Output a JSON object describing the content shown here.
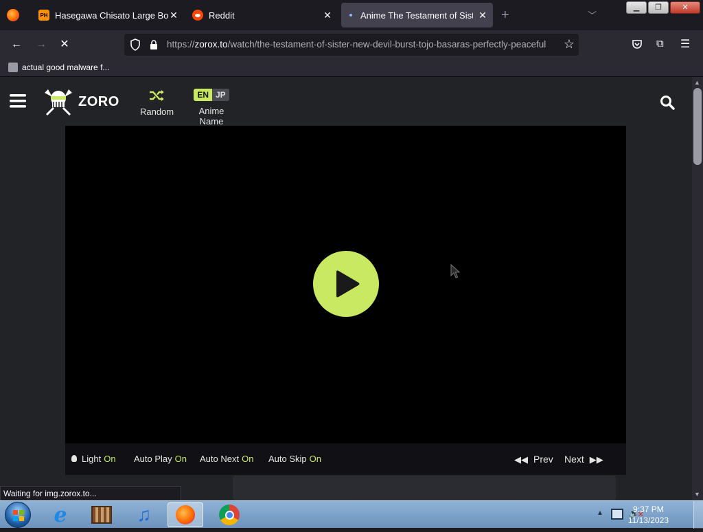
{
  "browser": {
    "tabs": [
      {
        "title": "Hasegawa Chisato Large Boobs",
        "favicon_text": "PH"
      },
      {
        "title": "Reddit"
      },
      {
        "title": "Anime The Testament of Sister New Devil",
        "active": true
      }
    ],
    "url": {
      "prefix": "https://",
      "domain": "zorox.to",
      "path": "/watch/the-testament-of-sister-new-devil-burst-tojo-basaras-perfectly-peaceful"
    },
    "bookmarks": [
      {
        "label": "actual good malware f..."
      }
    ],
    "status_text": "Waiting for img.zorox.to..."
  },
  "site": {
    "logo_text": "ZORO",
    "random_label": "Random",
    "lang_en": "EN",
    "lang_jp": "JP",
    "anime_name_label": "Anime Name",
    "accent_color": "#cae962"
  },
  "player_controls": {
    "light_label": "Light",
    "light_state": "On",
    "autoplay_label": "Auto Play",
    "autoplay_state": "On",
    "autonext_label": "Auto Next",
    "autonext_state": "On",
    "autoskip_label": "Auto Skip",
    "autoskip_state": "On",
    "prev_label": "Prev",
    "next_label": "Next"
  },
  "taskbar": {
    "time": "9:37 PM",
    "date": "11/13/2023",
    "apps": [
      "start-orb-icon",
      "internet-explorer-icon",
      "media-center-icon",
      "itunes-icon",
      "firefox-icon",
      "chrome-icon"
    ]
  }
}
